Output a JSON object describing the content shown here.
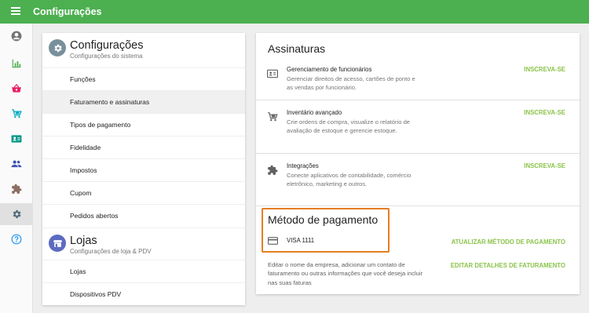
{
  "topbar": {
    "title": "Configurações"
  },
  "rail": [
    {
      "name": "account-icon",
      "color": "#757575"
    },
    {
      "name": "bar-chart-icon",
      "color": "#4caf50"
    },
    {
      "name": "basket-icon",
      "color": "#e91e63"
    },
    {
      "name": "cart-icon",
      "color": "#00acc1"
    },
    {
      "name": "id-card-icon",
      "color": "#009688"
    },
    {
      "name": "people-icon",
      "color": "#3f51b5"
    },
    {
      "name": "puzzle-icon",
      "color": "#8d6e63"
    },
    {
      "name": "gear-icon",
      "color": "#546e7a"
    },
    {
      "name": "help-icon",
      "color": "#2196f3"
    }
  ],
  "settings": {
    "title": "Configurações",
    "subtitle": "Configurações do sistema",
    "items": [
      "Funções",
      "Faturamento e assinaturas",
      "Tipos de pagamento",
      "Fidelidade",
      "Impostos",
      "Cupom",
      "Pedidos abertos"
    ]
  },
  "stores": {
    "title": "Lojas",
    "subtitle": "Configurações de loja & PDV",
    "items": [
      "Lojas",
      "Dispositivos PDV"
    ]
  },
  "subscriptions": {
    "title": "Assinaturas",
    "rows": [
      {
        "icon": "id-card-icon",
        "title": "Gerenciamento de funcionários",
        "desc": "Gerenciar direitos de acesso, cartões de ponto e as vendas por funcionário.",
        "button": "INSCREVA-SE"
      },
      {
        "icon": "cart-icon",
        "title": "Inventário avançado",
        "desc": "Crie ordens de compra, visualize o relatório de avaliação de estoque e gerencie estoque.",
        "button": "INSCREVA-SE"
      },
      {
        "icon": "puzzle-icon",
        "title": "Integrações",
        "desc": "Conecte aplicativos de contabilidade, comércio eletrônico, marketing e outros.",
        "button": "INSCREVA-SE"
      }
    ]
  },
  "payment": {
    "title": "Método de pagamento",
    "card_label": "VISA 1111",
    "update_button": "ATUALIZAR MÉTODO DE PAGAMENTO",
    "description": "Editar o nome da empresa, adicionar um contato de faturamento ou outras informações que você deseja incluir nas suas faturas",
    "billing_button": "EDITAR DETALHES DE FATURAMENTO"
  },
  "colors": {
    "brand": "#4caf50",
    "accent": "#8bc34a",
    "highlight": "#e67e22"
  }
}
